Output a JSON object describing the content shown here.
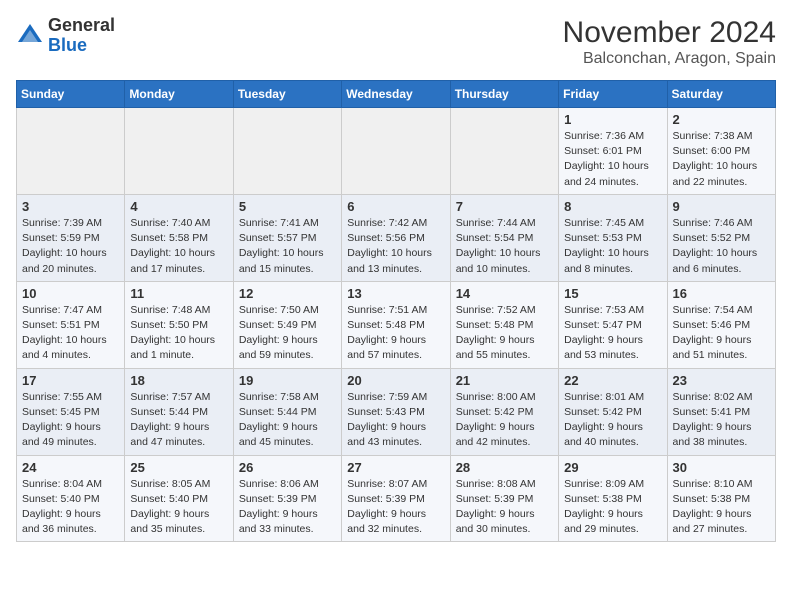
{
  "header": {
    "logo_general": "General",
    "logo_blue": "Blue",
    "month": "November 2024",
    "location": "Balconchan, Aragon, Spain"
  },
  "weekdays": [
    "Sunday",
    "Monday",
    "Tuesday",
    "Wednesday",
    "Thursday",
    "Friday",
    "Saturday"
  ],
  "weeks": [
    [
      {
        "day": "",
        "info": ""
      },
      {
        "day": "",
        "info": ""
      },
      {
        "day": "",
        "info": ""
      },
      {
        "day": "",
        "info": ""
      },
      {
        "day": "",
        "info": ""
      },
      {
        "day": "1",
        "info": "Sunrise: 7:36 AM\nSunset: 6:01 PM\nDaylight: 10 hours and 24 minutes."
      },
      {
        "day": "2",
        "info": "Sunrise: 7:38 AM\nSunset: 6:00 PM\nDaylight: 10 hours and 22 minutes."
      }
    ],
    [
      {
        "day": "3",
        "info": "Sunrise: 7:39 AM\nSunset: 5:59 PM\nDaylight: 10 hours and 20 minutes."
      },
      {
        "day": "4",
        "info": "Sunrise: 7:40 AM\nSunset: 5:58 PM\nDaylight: 10 hours and 17 minutes."
      },
      {
        "day": "5",
        "info": "Sunrise: 7:41 AM\nSunset: 5:57 PM\nDaylight: 10 hours and 15 minutes."
      },
      {
        "day": "6",
        "info": "Sunrise: 7:42 AM\nSunset: 5:56 PM\nDaylight: 10 hours and 13 minutes."
      },
      {
        "day": "7",
        "info": "Sunrise: 7:44 AM\nSunset: 5:54 PM\nDaylight: 10 hours and 10 minutes."
      },
      {
        "day": "8",
        "info": "Sunrise: 7:45 AM\nSunset: 5:53 PM\nDaylight: 10 hours and 8 minutes."
      },
      {
        "day": "9",
        "info": "Sunrise: 7:46 AM\nSunset: 5:52 PM\nDaylight: 10 hours and 6 minutes."
      }
    ],
    [
      {
        "day": "10",
        "info": "Sunrise: 7:47 AM\nSunset: 5:51 PM\nDaylight: 10 hours and 4 minutes."
      },
      {
        "day": "11",
        "info": "Sunrise: 7:48 AM\nSunset: 5:50 PM\nDaylight: 10 hours and 1 minute."
      },
      {
        "day": "12",
        "info": "Sunrise: 7:50 AM\nSunset: 5:49 PM\nDaylight: 9 hours and 59 minutes."
      },
      {
        "day": "13",
        "info": "Sunrise: 7:51 AM\nSunset: 5:48 PM\nDaylight: 9 hours and 57 minutes."
      },
      {
        "day": "14",
        "info": "Sunrise: 7:52 AM\nSunset: 5:48 PM\nDaylight: 9 hours and 55 minutes."
      },
      {
        "day": "15",
        "info": "Sunrise: 7:53 AM\nSunset: 5:47 PM\nDaylight: 9 hours and 53 minutes."
      },
      {
        "day": "16",
        "info": "Sunrise: 7:54 AM\nSunset: 5:46 PM\nDaylight: 9 hours and 51 minutes."
      }
    ],
    [
      {
        "day": "17",
        "info": "Sunrise: 7:55 AM\nSunset: 5:45 PM\nDaylight: 9 hours and 49 minutes."
      },
      {
        "day": "18",
        "info": "Sunrise: 7:57 AM\nSunset: 5:44 PM\nDaylight: 9 hours and 47 minutes."
      },
      {
        "day": "19",
        "info": "Sunrise: 7:58 AM\nSunset: 5:44 PM\nDaylight: 9 hours and 45 minutes."
      },
      {
        "day": "20",
        "info": "Sunrise: 7:59 AM\nSunset: 5:43 PM\nDaylight: 9 hours and 43 minutes."
      },
      {
        "day": "21",
        "info": "Sunrise: 8:00 AM\nSunset: 5:42 PM\nDaylight: 9 hours and 42 minutes."
      },
      {
        "day": "22",
        "info": "Sunrise: 8:01 AM\nSunset: 5:42 PM\nDaylight: 9 hours and 40 minutes."
      },
      {
        "day": "23",
        "info": "Sunrise: 8:02 AM\nSunset: 5:41 PM\nDaylight: 9 hours and 38 minutes."
      }
    ],
    [
      {
        "day": "24",
        "info": "Sunrise: 8:04 AM\nSunset: 5:40 PM\nDaylight: 9 hours and 36 minutes."
      },
      {
        "day": "25",
        "info": "Sunrise: 8:05 AM\nSunset: 5:40 PM\nDaylight: 9 hours and 35 minutes."
      },
      {
        "day": "26",
        "info": "Sunrise: 8:06 AM\nSunset: 5:39 PM\nDaylight: 9 hours and 33 minutes."
      },
      {
        "day": "27",
        "info": "Sunrise: 8:07 AM\nSunset: 5:39 PM\nDaylight: 9 hours and 32 minutes."
      },
      {
        "day": "28",
        "info": "Sunrise: 8:08 AM\nSunset: 5:39 PM\nDaylight: 9 hours and 30 minutes."
      },
      {
        "day": "29",
        "info": "Sunrise: 8:09 AM\nSunset: 5:38 PM\nDaylight: 9 hours and 29 minutes."
      },
      {
        "day": "30",
        "info": "Sunrise: 8:10 AM\nSunset: 5:38 PM\nDaylight: 9 hours and 27 minutes."
      }
    ]
  ]
}
